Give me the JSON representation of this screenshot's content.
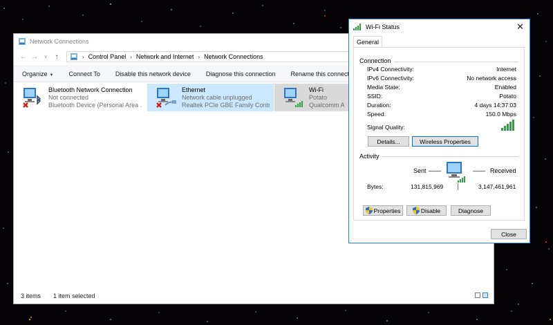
{
  "network_window": {
    "title": "Network Connections",
    "breadcrumb": [
      "Control Panel",
      "Network and Internet",
      "Network Connections"
    ],
    "toolbar": {
      "organize": "Organize",
      "connect_to": "Connect To",
      "disable_device": "Disable this network device",
      "diagnose": "Diagnose this connection",
      "rename": "Rename this connection"
    },
    "connections": [
      {
        "name": "Bluetooth Network Connection",
        "status": "Not connected",
        "device": "Bluetooth Device (Personal Area ..."
      },
      {
        "name": "Ethernet",
        "status": "Network cable unplugged",
        "device": "Realtek PCIe GBE Family Controller"
      },
      {
        "name": "Wi-Fi",
        "status": "Potato",
        "device": "Qualcomm Athe"
      }
    ],
    "status_bar": {
      "count": "3 items",
      "selected": "1 item selected"
    }
  },
  "wifi_dialog": {
    "title": "Wi-Fi Status",
    "tab": "General",
    "connection_group": "Connection",
    "fields": [
      {
        "label": "IPv4 Connectivity:",
        "value": "Internet"
      },
      {
        "label": "IPv6 Connectivity:",
        "value": "No network access"
      },
      {
        "label": "Media State:",
        "value": "Enabled"
      },
      {
        "label": "SSID:",
        "value": "Potato"
      },
      {
        "label": "Duration:",
        "value": "4 days 14:37:03"
      },
      {
        "label": "Speed:",
        "value": "150.0 Mbps"
      }
    ],
    "signal_quality_label": "Signal Quality:",
    "signal_bars": 5,
    "details_button": "Details...",
    "wireless_properties_button": "Wireless Properties",
    "activity_group": "Activity",
    "sent_label": "Sent",
    "received_label": "Received",
    "bytes_label": "Bytes:",
    "bytes_sent": "131,815,969",
    "bytes_received": "3,147,461,961",
    "properties_button": "Properties",
    "disable_button": "Disable",
    "diagnose_button": "Diagnose",
    "close_button": "Close"
  },
  "colors": {
    "accent": "#1883d7",
    "selection": "#cce8ff",
    "signal_green": "#2ea043"
  }
}
